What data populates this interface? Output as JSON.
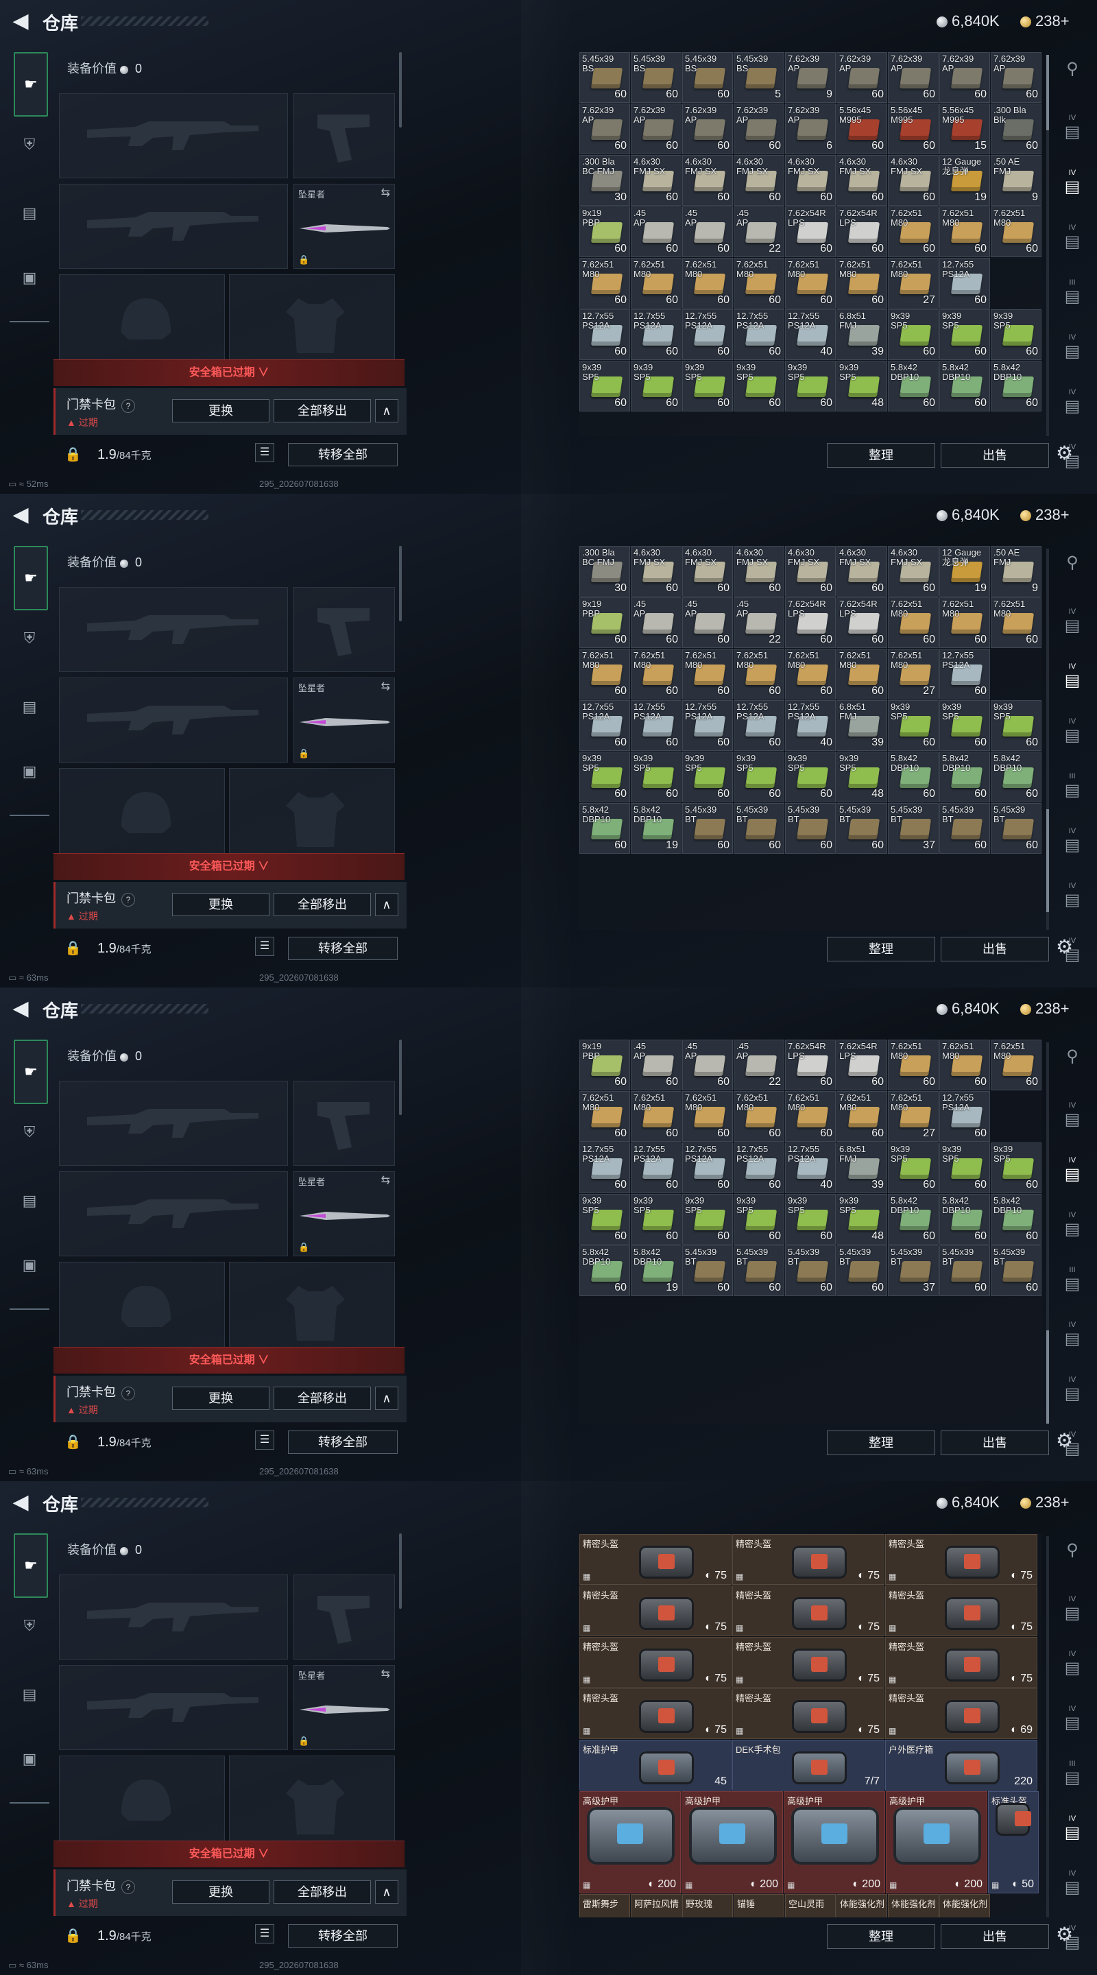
{
  "header": {
    "title": "仓库",
    "silver": "6,840K",
    "gold": "238+"
  },
  "equip": {
    "value_label": "装备价值",
    "value": "0",
    "melee_label": "坠星者",
    "safe_box_expired": "安全箱已过期",
    "card_name": "门禁卡包",
    "card_help": "?",
    "card_status": "过期",
    "swap_btn": "更换",
    "move_all_btn": "全部移出",
    "weight": "1.9",
    "weight_max": "/84千克",
    "transfer_all_btn": "转移全部"
  },
  "bottom": {
    "sort_btn": "整理",
    "sell_btn": "出售"
  },
  "status": {
    "ping1": "52ms",
    "ping2": "63ms",
    "ping3": "63ms",
    "ping4": "63ms",
    "build": "295_202607081638"
  },
  "icons": [
    "gun-icon",
    "shield-icon",
    "clipboard-icon",
    "briefcase-icon"
  ],
  "right_tabs": [
    "IV",
    "IV",
    "IV",
    "III",
    "IV",
    "IV",
    "IV"
  ],
  "ammo_rows_1": [
    [
      [
        "5.45x39\nBS",
        "60",
        "#8c7a55"
      ],
      [
        "5.45x39\nBS",
        "60",
        "#8c7a55"
      ],
      [
        "5.45x39\nBS",
        "60",
        "#8c7a55"
      ],
      [
        "5.45x39\nBS",
        "5",
        "#8c7a55"
      ],
      [
        "7.62x39\nAP",
        "9",
        "#7d7a6b"
      ],
      [
        "7.62x39\nAP",
        "60",
        "#7d7a6b"
      ],
      [
        "7.62x39\nAP",
        "60",
        "#7d7a6b"
      ],
      [
        "7.62x39\nAP",
        "60",
        "#7d7a6b"
      ],
      [
        "7.62x39\nAP",
        "60",
        "#7d7a6b"
      ]
    ],
    [
      [
        "7.62x39\nAP",
        "60",
        "#7d7a6b"
      ],
      [
        "7.62x39\nAP",
        "60",
        "#7d7a6b"
      ],
      [
        "7.62x39\nAP",
        "60",
        "#7d7a6b"
      ],
      [
        "7.62x39\nAP",
        "60",
        "#7d7a6b"
      ],
      [
        "7.62x39\nAP",
        "6",
        "#7d7a6b"
      ],
      [
        "5.56x45\nM995",
        "60",
        "#a8402e"
      ],
      [
        "5.56x45\nM995",
        "60",
        "#a8402e"
      ],
      [
        "5.56x45\nM995",
        "15",
        "#a8402e"
      ],
      [
        ".300 Bla\nBlk",
        "60",
        "#6b6e66"
      ]
    ],
    [
      [
        ".300 Bla\nBC FMJ",
        "30",
        "#8b8b82"
      ],
      [
        "4.6x30\nFMJ SX",
        "60",
        "#b7b39d"
      ],
      [
        "4.6x30\nFMJ SX",
        "60",
        "#b7b39d"
      ],
      [
        "4.6x30\nFMJ SX",
        "60",
        "#b7b39d"
      ],
      [
        "4.6x30\nFMJ SX",
        "60",
        "#b7b39d"
      ],
      [
        "4.6x30\nFMJ SX",
        "60",
        "#b7b39d"
      ],
      [
        "4.6x30\nFMJ SX",
        "60",
        "#b7b39d"
      ],
      [
        "12 Gauge\n龙息弹",
        "19",
        "#c99b3a"
      ],
      [
        ".50 AE\nFMJ",
        "9",
        "#b7b39d"
      ]
    ],
    [
      [
        "9x19\nPBP",
        "60",
        "#a6c06a"
      ],
      [
        ".45\nAP",
        "60",
        "#b8b8b0"
      ],
      [
        ".45\nAP",
        "60",
        "#b8b8b0"
      ],
      [
        ".45\nAP",
        "22",
        "#b8b8b0"
      ],
      [
        "7.62x54R\nLPS",
        "60",
        "#d0d0cf"
      ],
      [
        "7.62x54R\nLPS",
        "60",
        "#d0d0cf"
      ],
      [
        "7.62x51\nM80",
        "60",
        "#c8a05a"
      ],
      [
        "7.62x51\nM80",
        "60",
        "#c8a05a"
      ],
      [
        "7.62x51\nM80",
        "60",
        "#c8a05a"
      ]
    ],
    [
      [
        "7.62x51\nM80",
        "60",
        "#c8a05a"
      ],
      [
        "7.62x51\nM80",
        "60",
        "#c8a05a"
      ],
      [
        "7.62x51\nM80",
        "60",
        "#c8a05a"
      ],
      [
        "7.62x51\nM80",
        "60",
        "#c8a05a"
      ],
      [
        "7.62x51\nM80",
        "60",
        "#c8a05a"
      ],
      [
        "7.62x51\nM80",
        "60",
        "#c8a05a"
      ],
      [
        "7.62x51\nM80",
        "27",
        "#c8a05a"
      ],
      [
        "12.7x55\nPS12A",
        "60",
        "#a7b8c0"
      ]
    ],
    [
      [
        "12.7x55\nPS12A",
        "60",
        "#a7b8c0"
      ],
      [
        "12.7x55\nPS12A",
        "60",
        "#a7b8c0"
      ],
      [
        "12.7x55\nPS12A",
        "60",
        "#a7b8c0"
      ],
      [
        "12.7x55\nPS12A",
        "60",
        "#a7b8c0"
      ],
      [
        "12.7x55\nPS12A",
        "40",
        "#a7b8c0"
      ],
      [
        "6.8x51\nFMJ",
        "39",
        "#9aa49e"
      ],
      [
        "9x39\nSP5",
        "60",
        "#8fbd4e"
      ],
      [
        "9x39\nSP5",
        "60",
        "#8fbd4e"
      ],
      [
        "9x39\nSP5",
        "60",
        "#8fbd4e"
      ]
    ],
    [
      [
        "9x39\nSP5",
        "60",
        "#8fbd4e"
      ],
      [
        "9x39\nSP5",
        "60",
        "#8fbd4e"
      ],
      [
        "9x39\nSP5",
        "60",
        "#8fbd4e"
      ],
      [
        "9x39\nSP5",
        "60",
        "#8fbd4e"
      ],
      [
        "9x39\nSP5",
        "60",
        "#8fbd4e"
      ],
      [
        "9x39\nSP5",
        "48",
        "#8fbd4e"
      ],
      [
        "5.8x42\nDBP10",
        "60",
        "#7fb07a"
      ],
      [
        "5.8x42\nDBP10",
        "60",
        "#7fb07a"
      ],
      [
        "5.8x42\nDBP10",
        "60",
        "#7fb07a"
      ]
    ]
  ],
  "ammo_rows_tail": [
    [
      [
        "5.8x42\nDBP10",
        "60",
        "#7fb07a"
      ],
      [
        "5.8x42\nDBP10",
        "19",
        "#7fb07a"
      ],
      [
        "5.45x39\nBT",
        "60",
        "#8c7a55"
      ],
      [
        "5.45x39\nBT",
        "60",
        "#8c7a55"
      ],
      [
        "5.45x39\nBT",
        "60",
        "#8c7a55"
      ],
      [
        "5.45x39\nBT",
        "60",
        "#8c7a55"
      ],
      [
        "5.45x39\nBT",
        "37",
        "#8c7a55"
      ],
      [
        "5.45x39\nBT",
        "60",
        "#8c7a55"
      ],
      [
        "5.45x39\nBT",
        "60",
        "#8c7a55"
      ]
    ]
  ],
  "gear": {
    "helmets": [
      [
        "精密头盔",
        "75"
      ],
      [
        "精密头盔",
        "75"
      ],
      [
        "精密头盔",
        "75"
      ],
      [
        "精密头盔",
        "75"
      ],
      [
        "精密头盔",
        "75"
      ],
      [
        "精密头盔",
        "75"
      ],
      [
        "精密头盔",
        "75"
      ],
      [
        "精密头盔",
        "75"
      ],
      [
        "精密头盔",
        "75"
      ],
      [
        "精密头盔",
        "75"
      ],
      [
        "精密头盔",
        "75"
      ],
      [
        "精密头盔",
        "69"
      ]
    ],
    "row5": [
      [
        "标准护甲",
        "45"
      ],
      [
        "DEK手术包",
        "7/7"
      ],
      [
        "户外医疗箱",
        "220"
      ]
    ],
    "armors": [
      [
        "高级护甲",
        "200"
      ],
      [
        "高级护甲",
        "200"
      ],
      [
        "高级护甲",
        "200"
      ],
      [
        "高级护甲",
        "200"
      ],
      [
        "标准头盔",
        "50"
      ]
    ],
    "bottom_labels": [
      "雷斯舞步",
      "阿萨拉风情",
      "野玫瑰",
      "锚锤",
      "空山灵雨",
      "体能强化剂",
      "体能强化剂",
      "体能强化剂"
    ]
  }
}
